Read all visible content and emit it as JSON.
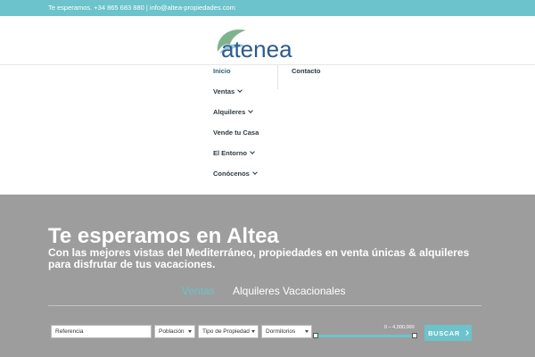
{
  "topbar": {
    "contact_text": "Te esperamos. +34 865 683 880 | info@altea-propiedades.com"
  },
  "brand": {
    "logo_text": "atenea",
    "colors": {
      "accent": "#6cc3cb",
      "logo_green": "#7fb38e",
      "logo_blue": "#2c5a8c"
    }
  },
  "menu": {
    "left": [
      {
        "label": "Inicio",
        "active": true,
        "dropdown": false
      },
      {
        "label": "Ventas",
        "active": false,
        "dropdown": true
      },
      {
        "label": "Alquileres",
        "active": false,
        "dropdown": true
      },
      {
        "label": "Vende tu Casa",
        "active": false,
        "dropdown": false
      },
      {
        "label": "El Entorno",
        "active": false,
        "dropdown": true
      },
      {
        "label": "Conócenos",
        "active": false,
        "dropdown": true
      }
    ],
    "right": [
      {
        "label": "Contacto",
        "active": false,
        "dropdown": false
      }
    ]
  },
  "hero": {
    "title": "Te esperamos en Altea",
    "subtitle": "Con las mejores vistas del Mediterráneo, propiedades en venta únicas & alquileres para disfrutar de tus vacaciones."
  },
  "search": {
    "tabs": [
      {
        "label": "Ventas",
        "active": true
      },
      {
        "label": "Alquileres Vacacionales",
        "active": false
      }
    ],
    "reference_placeholder": "Referencia",
    "poblacion_label": "Población",
    "tipo_label": "Tipo de Propiedad",
    "dormitorios_label": "Dormitorios",
    "price_range_label": "0 – 4,000,000",
    "price_range": [
      0,
      4000000
    ],
    "button_label": "BUSCAR"
  }
}
